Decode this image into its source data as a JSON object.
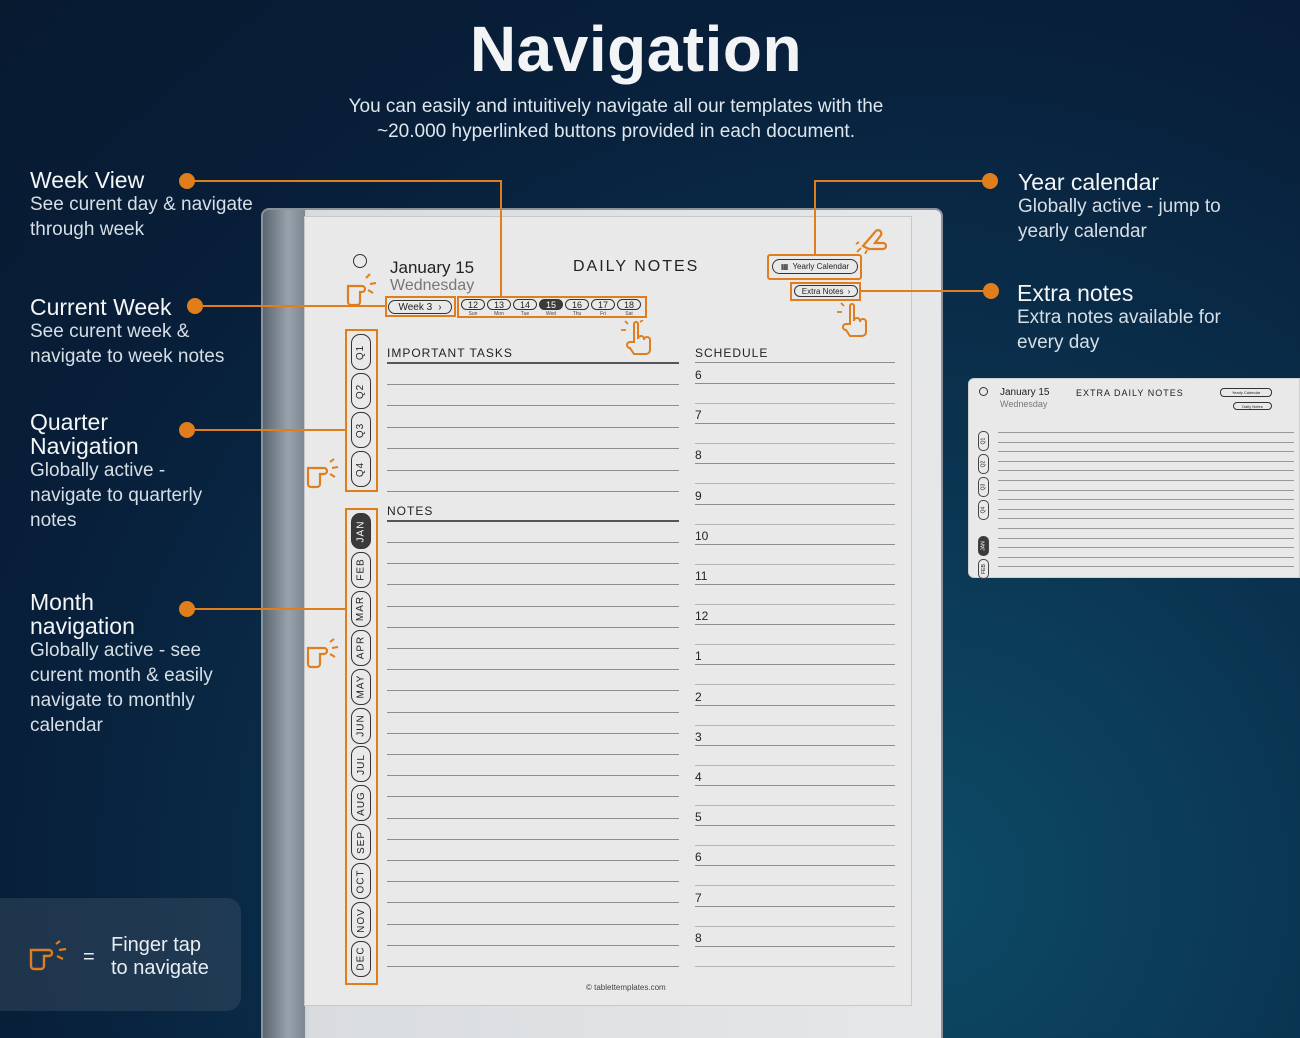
{
  "header": {
    "title": "Navigation",
    "subtitle": "You can easily and intuitively navigate all our templates with the ~20.000 hyperlinked buttons provided in each document."
  },
  "annotations": {
    "week_view": {
      "title": "Week View",
      "desc": "See curent day & navigate through week"
    },
    "current_week": {
      "title": "Current Week",
      "desc": "See curent week & navigate to week notes"
    },
    "quarter_nav": {
      "title": "Quarter Navigation",
      "desc": "Globally active - navigate to quarterly notes"
    },
    "month_nav": {
      "title": "Month navigation",
      "desc": "Globally active - see curent month & easily navigate to monthly calendar"
    },
    "year_calendar": {
      "title": "Year calendar",
      "desc": "Globally active - jump to yearly calendar"
    },
    "extra_notes": {
      "title": "Extra notes",
      "desc": "Extra notes available for every day"
    }
  },
  "legend": {
    "equals": "=",
    "text": "Finger tap to navigate"
  },
  "page": {
    "date": "January 15",
    "weekday": "Wednesday",
    "heading": "DAILY NOTES",
    "week_button": "Week 3",
    "yearly_button": "Yearly Calendar",
    "extra_button": "Extra Notes",
    "days": [
      {
        "num": "12",
        "name": "Sun"
      },
      {
        "num": "13",
        "name": "Mon"
      },
      {
        "num": "14",
        "name": "Tue"
      },
      {
        "num": "15",
        "name": "Wed"
      },
      {
        "num": "16",
        "name": "Thu"
      },
      {
        "num": "17",
        "name": "Fri"
      },
      {
        "num": "18",
        "name": "Sat"
      }
    ],
    "active_day": "15",
    "quarters": [
      "Q1",
      "Q2",
      "Q3",
      "Q4"
    ],
    "months": [
      "JAN",
      "FEB",
      "MAR",
      "APR",
      "MAY",
      "JUN",
      "JUL",
      "AUG",
      "SEP",
      "OCT",
      "NOV",
      "DEC"
    ],
    "active_month": "JAN",
    "important_tasks": "IMPORTANT TASKS",
    "notes": "NOTES",
    "schedule": "SCHEDULE",
    "schedule_hours": [
      "6",
      "7",
      "8",
      "9",
      "10",
      "11",
      "12",
      "1",
      "2",
      "3",
      "4",
      "5",
      "6",
      "7",
      "8"
    ],
    "footer": "© tablettemplates.com"
  },
  "mini_page": {
    "date": "January 15",
    "weekday": "Wednesday",
    "heading": "EXTRA DAILY NOTES",
    "yearly_button": "Yearly Calendar",
    "daily_button": "Daily Notes",
    "quarters": [
      "Q1",
      "Q2",
      "Q3",
      "Q4"
    ],
    "months": [
      "JAN",
      "FEB"
    ]
  },
  "colors": {
    "accent": "#e07d1c",
    "background": "#081f3a"
  }
}
